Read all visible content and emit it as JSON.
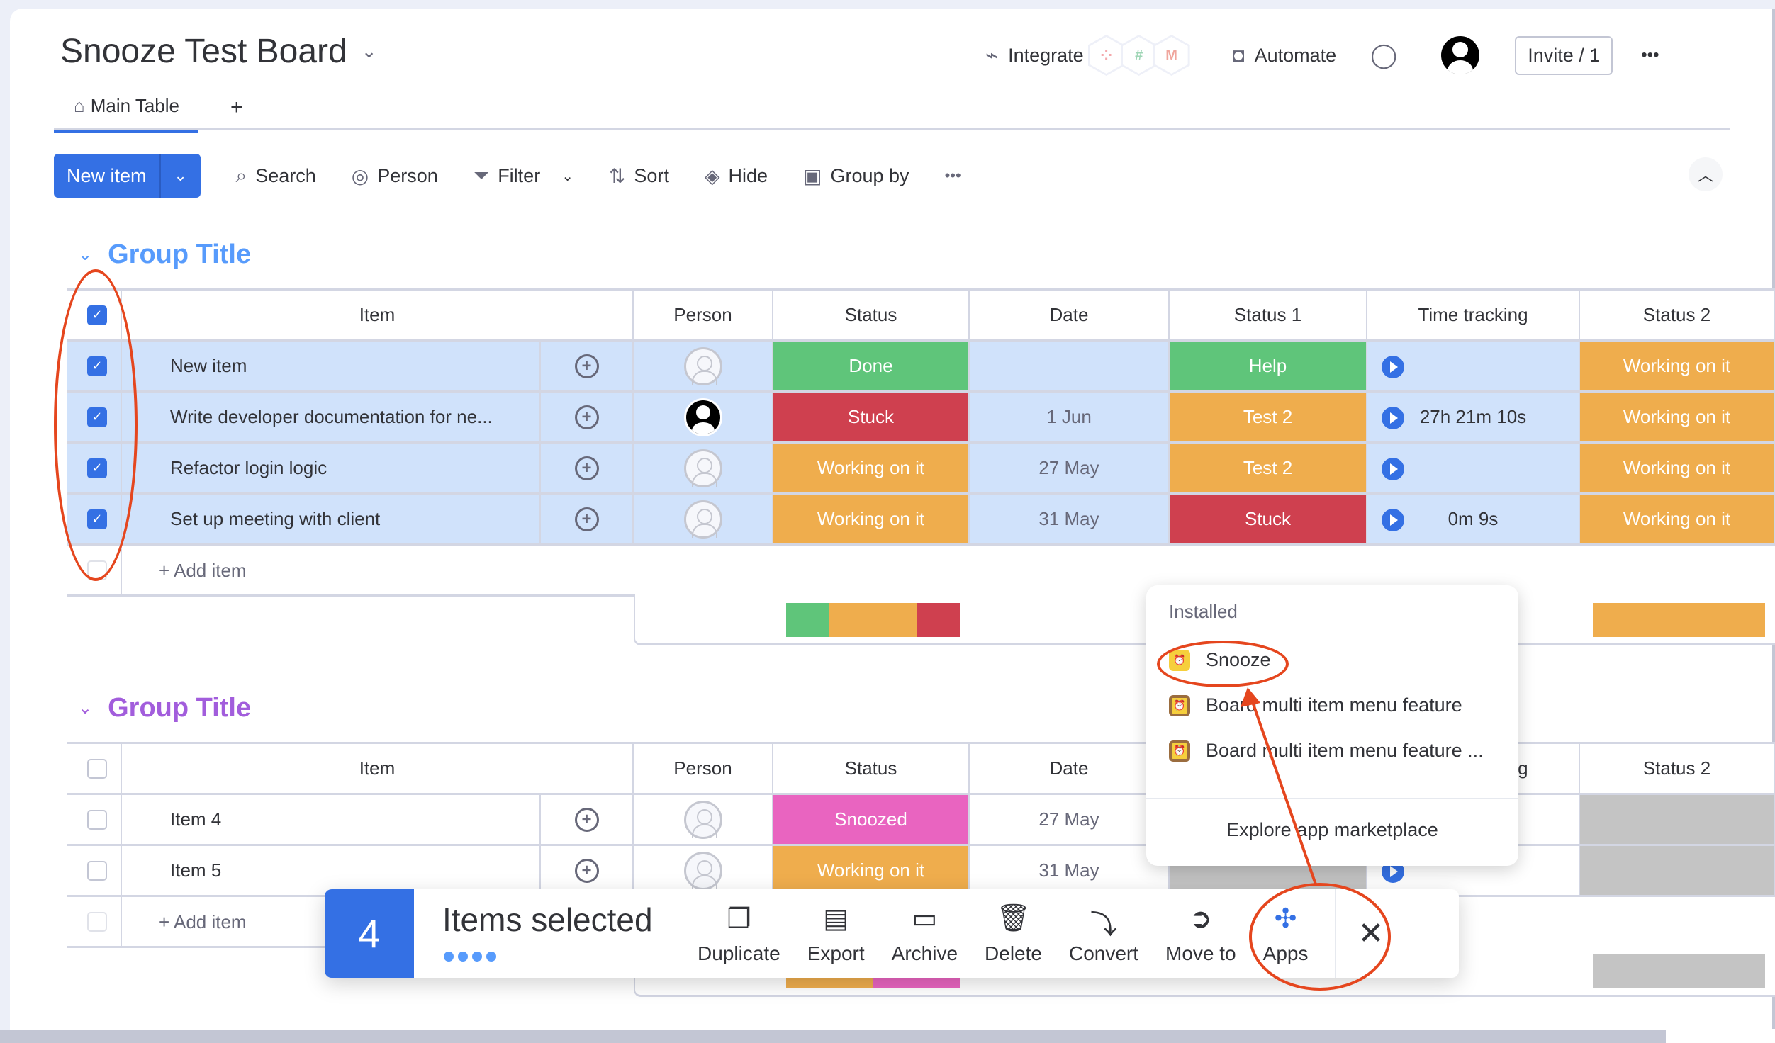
{
  "board": {
    "title": "Snooze Test Board",
    "title_chevron": "⌄",
    "tabs": [
      {
        "label": "Main Table",
        "icon": "home-icon"
      }
    ],
    "tab_add": "+"
  },
  "header": {
    "integrate": "Integrate",
    "integrations": [
      "twilio",
      "slack",
      "gmail"
    ],
    "automate": "Automate",
    "invite": "Invite / 1",
    "more": "•••"
  },
  "toolbar": {
    "new_item": "New item",
    "search": "Search",
    "person": "Person",
    "filter": "Filter",
    "sort": "Sort",
    "hide": "Hide",
    "group_by": "Group by",
    "more": "•••"
  },
  "columns": [
    "Item",
    "Person",
    "Status",
    "Date",
    "Status 1",
    "Time tracking",
    "Status 2"
  ],
  "colors": {
    "done": "#5fc57a",
    "stuck": "#cf404f",
    "working": "#efad4d",
    "snoozed": "#e964c0",
    "grey": "#c4c4c4",
    "primary": "#3470e4",
    "annotation": "#e5461e"
  },
  "groups": [
    {
      "title": "Group Title",
      "color": "#579bfc",
      "add_item": "+ Add item",
      "rows": [
        {
          "name": "New item",
          "checked": true,
          "person": "empty",
          "status": "Done",
          "date": "",
          "status1": "Help",
          "time": "",
          "status2": "Working on it"
        },
        {
          "name": "Write developer documentation for ne...",
          "checked": true,
          "person": "filled",
          "status": "Stuck",
          "date": "1 Jun",
          "status1": "Test 2",
          "time": "27h 21m 10s",
          "status2": "Working on it"
        },
        {
          "name": "Refactor login logic",
          "checked": true,
          "person": "empty",
          "status": "Working on it",
          "date": "27 May",
          "status1": "Test 2",
          "time": "",
          "status2": "Working on it"
        },
        {
          "name": "Set up meeting with client",
          "checked": true,
          "person": "empty",
          "status": "Working on it",
          "date": "31 May",
          "status1": "Stuck",
          "time": "0m 9s",
          "status2": "Working on it"
        }
      ],
      "status_summary": [
        {
          "label": "Done",
          "fraction": 0.25
        },
        {
          "label": "Working on it",
          "fraction": 0.5
        },
        {
          "label": "Stuck",
          "fraction": 0.25
        }
      ]
    },
    {
      "title": "Group Title",
      "color": "#a25ddc",
      "add_item": "+ Add item",
      "rows": [
        {
          "name": "Item 4",
          "checked": false,
          "person": "empty",
          "status": "Snoozed",
          "date": "27 May"
        },
        {
          "name": "Item 5",
          "checked": false,
          "person": "empty",
          "status": "Working on it",
          "date": "31 May"
        }
      ],
      "partial_header": "ng"
    }
  ],
  "apps_menu": {
    "section": "Installed",
    "items": [
      "Snooze",
      "Board multi item menu feature",
      "Board multi item menu feature ..."
    ],
    "footer": "Explore app marketplace"
  },
  "action_bar": {
    "count": "4",
    "label": "Items selected",
    "actions": [
      {
        "label": "Duplicate",
        "icon": "duplicate-icon"
      },
      {
        "label": "Export",
        "icon": "export-icon"
      },
      {
        "label": "Archive",
        "icon": "archive-icon"
      },
      {
        "label": "Delete",
        "icon": "delete-icon"
      },
      {
        "label": "Convert",
        "icon": "convert-icon"
      },
      {
        "label": "Move to",
        "icon": "move-to-icon"
      },
      {
        "label": "Apps",
        "icon": "apps-puzzle-icon"
      }
    ],
    "close": "✕"
  }
}
